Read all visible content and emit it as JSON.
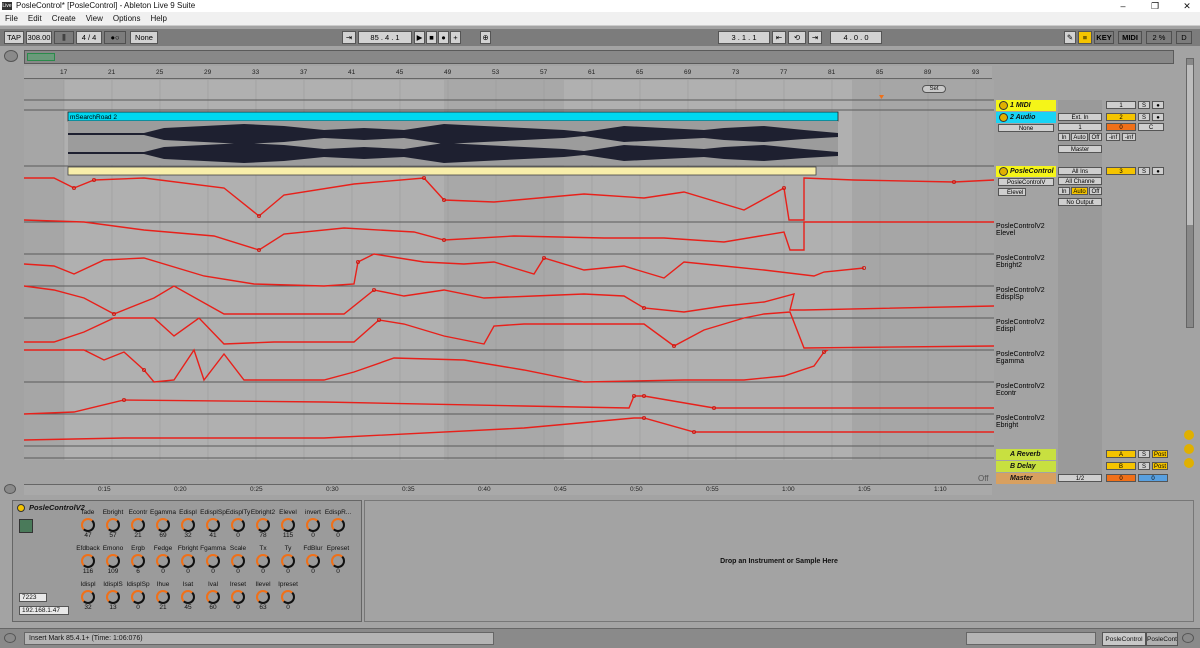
{
  "window": {
    "title": "PosleControl*  [PosleControl] - Ableton Live 9 Suite",
    "app_icon": "Live"
  },
  "menu": [
    "File",
    "Edit",
    "Create",
    "View",
    "Options",
    "Help"
  ],
  "transport": {
    "tap": "TAP",
    "tempo": "308.00",
    "signature": "4 / 4",
    "quantize": "None",
    "position": "85 .  4 .  1",
    "loop_start": "3 .  1 .  1",
    "loop_length": "4 .  0 .  0",
    "key": "KEY",
    "midi": "MIDI",
    "cpu": "2 %",
    "d": "D"
  },
  "ruler_bars": [
    "17",
    "21",
    "25",
    "29",
    "33",
    "37",
    "41",
    "45",
    "49",
    "53",
    "57",
    "61",
    "65",
    "69",
    "73",
    "77",
    "81",
    "85",
    "89",
    "93"
  ],
  "time_marks": [
    "0:15",
    "0:20",
    "0:25",
    "0:30",
    "0:35",
    "0:40",
    "0:45",
    "0:50",
    "0:55",
    "1:00",
    "1:05",
    "1:10"
  ],
  "set_label": "Set",
  "clip_name": "mSearchRoad 2",
  "tracks": [
    {
      "name": "1 MIDI",
      "number": "1",
      "color": "#f5f518"
    },
    {
      "name": "2 Audio",
      "number": "2",
      "color": "#18d4f5",
      "input": "Ext. In",
      "channel": "1",
      "monitor": "None",
      "out": "Master",
      "vol": "0",
      "pan": "C",
      "db1": "-inf",
      "db2": "-inf"
    },
    {
      "name": "PosleControl",
      "number": "3",
      "color": "#f5f518",
      "input": "All Ins",
      "ch": "All Channe",
      "dev": "PosleControlV",
      "param": "Elevel",
      "out": "No Output"
    }
  ],
  "monitor": {
    "in": "In",
    "auto": "Auto",
    "off": "Off"
  },
  "lanes": [
    {
      "device": "PosleControlV2",
      "param": "Elevel"
    },
    {
      "device": "PosleControlV2",
      "param": "Ebright2"
    },
    {
      "device": "PosleControlV2",
      "param": "EdisplSp"
    },
    {
      "device": "PosleControlV2",
      "param": "Edispl"
    },
    {
      "device": "PosleControlV2",
      "param": "Egamma"
    },
    {
      "device": "PosleControlV2",
      "param": "Econtr"
    },
    {
      "device": "PosleControlV2",
      "param": "Ebright"
    }
  ],
  "returns": [
    {
      "name": "A Reverb",
      "letter": "A",
      "post": "Post"
    },
    {
      "name": "B Delay",
      "letter": "B",
      "post": "Post"
    },
    {
      "name": "Master",
      "sel": "1/2",
      "vol": "0",
      "db": "0"
    }
  ],
  "solo": "S",
  "off_label": "Off",
  "device": {
    "name": "PosleControlV2",
    "port": "7223",
    "ip": "192.168.1.47",
    "row1": [
      {
        "l": "fade",
        "v": "47"
      },
      {
        "l": "Ebright",
        "v": "57"
      },
      {
        "l": "Econtr",
        "v": "21"
      },
      {
        "l": "Egamma",
        "v": "69"
      },
      {
        "l": "Edispl",
        "v": "32"
      },
      {
        "l": "EdisplSp",
        "v": "41"
      },
      {
        "l": "EdisplTy",
        "v": "0"
      },
      {
        "l": "Ebright2",
        "v": "78"
      },
      {
        "l": "Elevel",
        "v": "115"
      },
      {
        "l": "invert",
        "v": "0"
      },
      {
        "l": "EdispR...",
        "v": "0"
      }
    ],
    "row2": [
      {
        "l": "Efdback",
        "v": "116"
      },
      {
        "l": "Emono",
        "v": "109"
      },
      {
        "l": "Ergb",
        "v": "6"
      },
      {
        "l": "Fedge",
        "v": "0"
      },
      {
        "l": "Fbright",
        "v": "0"
      },
      {
        "l": "Fgamma",
        "v": "0"
      },
      {
        "l": "Scale",
        "v": "0"
      },
      {
        "l": "Tx",
        "v": "0"
      },
      {
        "l": "Ty",
        "v": "0"
      },
      {
        "l": "FdBlur",
        "v": "0"
      },
      {
        "l": "Epreset",
        "v": "0"
      }
    ],
    "row3": [
      {
        "l": "Idispl",
        "v": "32"
      },
      {
        "l": "IdisplS",
        "v": "13"
      },
      {
        "l": "IdisplSp",
        "v": "0"
      },
      {
        "l": "Ihue",
        "v": "21"
      },
      {
        "l": "Isat",
        "v": "45"
      },
      {
        "l": "Ival",
        "v": "60"
      },
      {
        "l": "Ireset",
        "v": "0"
      },
      {
        "l": "Ilevel",
        "v": "63"
      },
      {
        "l": "Ipreset",
        "v": "0"
      }
    ]
  },
  "drop_hint": "Drop an Instrument or Sample Here",
  "status": "Insert Mark 85.4.1+ (Time: 1:06:076)",
  "bottom_tabs": [
    "PosleControl",
    "PosleContro"
  ],
  "colors": {
    "automation": "#e8201a",
    "audio_clip": "#00d8f0",
    "yellow": "#f5c400"
  }
}
